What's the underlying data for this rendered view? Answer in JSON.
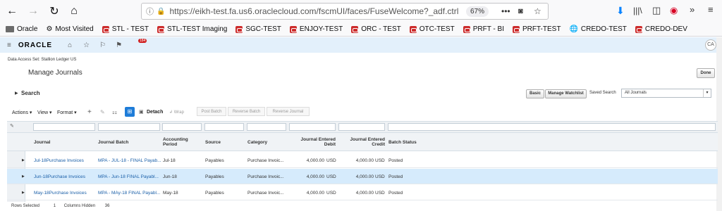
{
  "browser": {
    "url": "https://eikh-test.fa.us6.oraclecloud.com/fscmUI/faces/FuseWelcome?_adf.ctrl-st",
    "zoom": "67%",
    "bookmarks": [
      "Oracle",
      "Most Visited",
      "STL - TEST",
      "STL-TEST Imaging",
      "SGC-TEST",
      "ENJOY-TEST",
      "ORC - TEST",
      "OTC-TEST",
      "PRFT - BI",
      "PRFT-TEST",
      "CREDO-TEST",
      "CREDO-DEV"
    ]
  },
  "header": {
    "logo": "ORACLE",
    "notifications": "184",
    "user": "CA"
  },
  "page": {
    "data_access_set": "Data Access Set: Stallion Ledger US",
    "title": "Manage Journals",
    "done": "Done",
    "search": "Search",
    "basic": "Basic",
    "manage_watchlist": "Manage Watchlist",
    "saved_search_label": "Saved Search",
    "saved_search_value": "All Journals"
  },
  "toolbar": {
    "actions": "Actions",
    "view": "View",
    "format": "Format",
    "detach": "Detach",
    "wrap": "Wrap",
    "post_batch": "Post Batch",
    "reverse_batch": "Reverse Batch",
    "reverse_journal": "Reverse Journal"
  },
  "table": {
    "columns": [
      "Journal",
      "Journal Batch",
      "Accounting Period",
      "Source",
      "Category",
      "Journal Entered Debit",
      "Journal Entered Credit",
      "Batch Status"
    ],
    "rows": [
      {
        "journal": "Jul-18Purchase Invoices",
        "batch": "MPA - JUL-18 - FINAL Payab...",
        "period": "Jul-18",
        "source": "Payables",
        "category": "Purchase Invoic...",
        "debit": "4,000.00",
        "debit_cur": "USD",
        "credit": "4,000.00",
        "credit_cur": "USD",
        "status": "Posted"
      },
      {
        "journal": "Jun-18Purchase Invoices",
        "batch": "MPA - Jun-18 FINAL Payabl...",
        "period": "Jun-18",
        "source": "Payables",
        "category": "Purchase Invoic...",
        "debit": "4,000.00",
        "debit_cur": "USD",
        "credit": "4,000.00",
        "credit_cur": "USD",
        "status": "Posted"
      },
      {
        "journal": "May-18Purchase Invoices",
        "batch": "MPA - MAy-18 FINAL Payabl...",
        "period": "May-18",
        "source": "Payables",
        "category": "Purchase Invoic...",
        "debit": "4,000.00",
        "debit_cur": "USD",
        "credit": "4,000.00",
        "credit_cur": "USD",
        "status": "Posted"
      }
    ]
  },
  "footer": {
    "rows_selected_label": "Rows Selected",
    "rows_selected": "1",
    "columns_hidden_label": "Columns Hidden",
    "columns_hidden": "36"
  }
}
